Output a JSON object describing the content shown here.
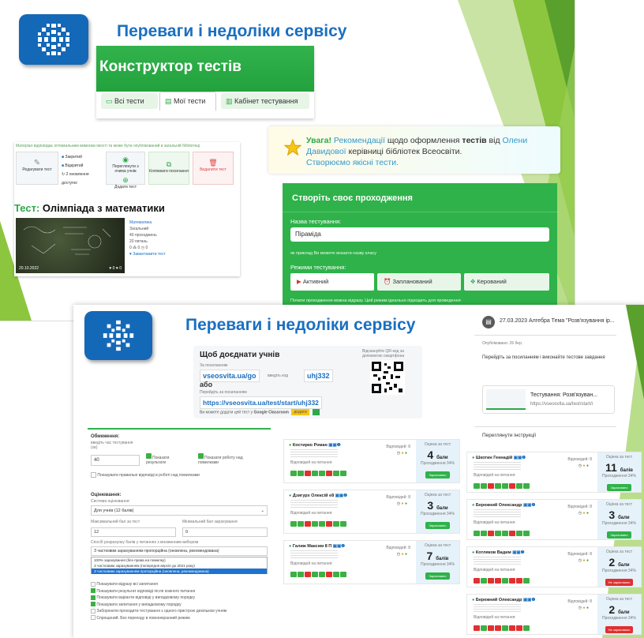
{
  "slide1": {
    "title": "Переваги і недоліки сервісу",
    "constructor": {
      "heading": "Конструктор тестів",
      "tabs": [
        {
          "label": "Всі тести"
        },
        {
          "label": "Мої тести"
        },
        {
          "label": "Кабінет тестування"
        }
      ]
    },
    "test_panel": {
      "top_note": "Матеріал відповідає оптимальним вимогам якості та може бути опублікований в загальній бібліотеці",
      "actions": {
        "edit": "Редагувати тест",
        "closed": "Закритий",
        "opened": "Відкритий",
        "updated": "2 оновлення доступні",
        "preview": "Переглянути з очима учнів",
        "add": "Додати тест",
        "copy": "Копіювати посилання",
        "delete": "Видалити тест"
      },
      "test_prefix": "Тест:",
      "test_title": "Олімпіада з математики",
      "date": "20.10.2022",
      "meta": [
        "Математика",
        "Загальний",
        "40 проходжень",
        "20 питань",
        "0 ⁂ 0 ◷ 0",
        "♥ Завантажити тест"
      ],
      "image_stats": "♥ 0 ♥ 0"
    },
    "warning": {
      "bold": "Увага!",
      "p1": " Рекомендації",
      "p2": " щодо оформлення ",
      "p3": "тестів",
      "p4": " від ",
      "p5": "Олени",
      "p6": "Давидової",
      "p7": " керівниці бібліотек Всеосвіти.",
      "p8": "Створюємо якісні тести."
    },
    "create_panel": {
      "header": "Створіть своє проходження",
      "name_label": "Назва тестування:",
      "name_value": "Піраміда",
      "hint": "як приклад Ви можете вказати назву класу",
      "modes_label": "Режими тестування:",
      "modes": [
        {
          "label": "Активний"
        },
        {
          "label": "Запланований"
        },
        {
          "label": "Керований"
        }
      ],
      "footer": "Почати проходження можна відразу. Цей режим ідеально підходить для проведення"
    }
  },
  "slide2": {
    "title": "Переваги і недоліки сервісу",
    "invite": {
      "heading": "Щоб доєднати учнів",
      "by_link": "За посиланням",
      "link1": "vseosvita.ua/go",
      "enter_code": "введіть код",
      "code": "uhj332",
      "or": "або",
      "follow": "Перейдіть за посиланням",
      "link2": "https://vseosvita.ua/test/start/uhj332",
      "classroom_text": "Ви можете додати цей тест у",
      "classroom_bold": "Google Classroom",
      "classroom_btn": "додати",
      "qr_text": "Відскануйте QR-код за допомогою смартфона"
    },
    "chat": {
      "title": "27.03.2023 Алгебра Тема \"Розв'язування ір...",
      "published": "Опубліковано: 26 бер.",
      "instruction": "Перейдіть за посиланням і виконайте тестове завдання",
      "link_title": "Тестування: Розв'язуван...",
      "link_url": "https://vseosvita.ua/test/start/i",
      "view_instructions": "Переглянути інструкції"
    },
    "settings": {
      "limits": "Обмеження:",
      "time_label": "введіть час тестування (хв)",
      "time_value": "40",
      "show_results": "Показати результати",
      "show_work": "Показати роботу над помилками",
      "show_correct": "Показувати правильні відповіді в роботі над помилками",
      "grading": "Оцінювання:",
      "system": "Система оцінювання:",
      "system_value": "Для учнів (12 балів)",
      "max_label": "Максимальний бал за тест",
      "max_value": "12",
      "min_label": "Мінімальний бал зарахування",
      "min_value": "0",
      "method_label": "Спосіб розрахунку балів у питаннях з множинним вибором",
      "method_value": "З частковим зарахуванням пропорційна (оновлена, рекомендована)",
      "options": [
        "100% зарахування (без права на помилку)",
        "З частковим зарахуванням (попередня версія до 2021 року)",
        "З частковим зарахуванням пропорційна (оновлена, рекомендована)"
      ],
      "checks": [
        "Показувати відразу всі запитання",
        "Показувати результат відповіді після кожного питання",
        "Показувати варіанти відповіді у випадковому порядку",
        "Показувати запитання у випадковому порядку",
        "Заборонити проходити тестування з одного пристрою декільком учням",
        "Спрощений. Без переходу в повноекранний режим"
      ]
    },
    "results_left": [
      {
        "name": "Костирко Роман",
        "score": "4",
        "unit": "бали",
        "status": "Зараховано"
      },
      {
        "name": "Дзигурх Олексій е8",
        "score": "3",
        "unit": "бали",
        "status": "Зараховано"
      },
      {
        "name": "Галиж Максим 8 П",
        "score": "7",
        "unit": "балів",
        "status": "Зараховано"
      }
    ],
    "results_right": [
      {
        "name": "Шкотин Геннадій",
        "score": "11",
        "unit": "балів",
        "status": "Зараховано"
      },
      {
        "name": "Бережний Олександр",
        "score": "3",
        "unit": "бали",
        "status": "Зараховано"
      },
      {
        "name": "Котляков Вадим",
        "score": "2",
        "unit": "бали",
        "status": "Не зараховано"
      },
      {
        "name": "Бережний Олександр",
        "score": "2",
        "unit": "бали",
        "status": "Не зараховано"
      }
    ],
    "result_labels": {
      "answers": "Відповідей на питання:",
      "correct": "Відповідей: 8",
      "percent": "Проходження 34%",
      "scored": "Оцінка за тест"
    }
  },
  "colors": {
    "title_blue": "#1a6fc0",
    "logo_blue": "#1468b8",
    "green": "#2fb24a",
    "red": "#e03030"
  }
}
